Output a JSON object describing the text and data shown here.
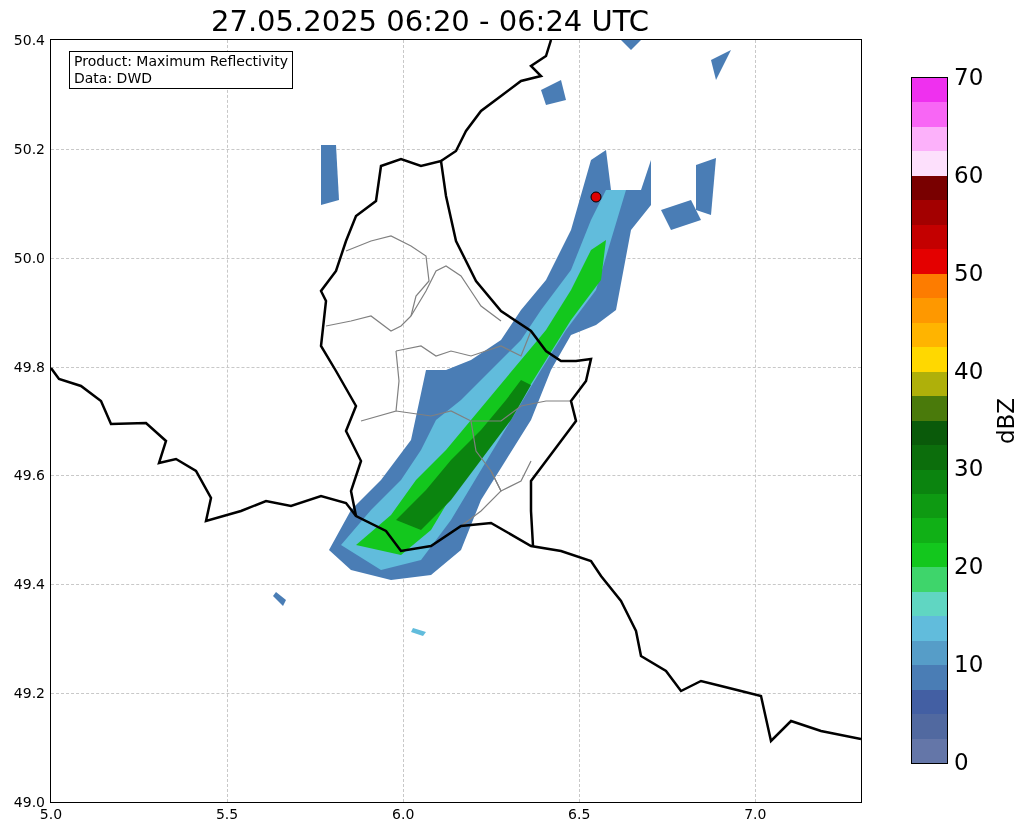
{
  "title": "27.05.2025 06:20 - 06:24 UTC",
  "info_box": {
    "lines": [
      "Product: Maximum Reflectivity",
      "Data: DWD"
    ]
  },
  "axes": {
    "xticks": [
      "5.0",
      "5.5",
      "6.0",
      "6.5",
      "7.0"
    ],
    "yticks": [
      "50.4",
      "50.2",
      "50.0",
      "49.8",
      "49.6",
      "49.4",
      "49.2",
      "49.0"
    ]
  },
  "colorbar": {
    "label": "dBZ",
    "ticks": [
      "70",
      "60",
      "50",
      "40",
      "30",
      "20",
      "10",
      "0"
    ],
    "bands": [
      {
        "color": "#ef30ef"
      },
      {
        "color": "#f866f5"
      },
      {
        "color": "#fcb1fa"
      },
      {
        "color": "#fde0fc"
      },
      {
        "color": "#790000"
      },
      {
        "color": "#a30000"
      },
      {
        "color": "#c40000"
      },
      {
        "color": "#e40000"
      },
      {
        "color": "#fd7c00"
      },
      {
        "color": "#fe9800"
      },
      {
        "color": "#ffb400"
      },
      {
        "color": "#ffd800"
      },
      {
        "color": "#afb00a"
      },
      {
        "color": "#4a7a0b"
      },
      {
        "color": "#0a5a0a"
      },
      {
        "color": "#0c6e0c"
      },
      {
        "color": "#0b840f"
      },
      {
        "color": "#0e9a12"
      },
      {
        "color": "#10b016"
      },
      {
        "color": "#13c71d"
      },
      {
        "color": "#3ed56b"
      },
      {
        "color": "#60d6c2"
      },
      {
        "color": "#61bcdc"
      },
      {
        "color": "#569dc8"
      },
      {
        "color": "#4a7db5"
      },
      {
        "color": "#435fa3"
      },
      {
        "color": "#5169a0"
      },
      {
        "color": "#6476a8"
      }
    ]
  }
}
